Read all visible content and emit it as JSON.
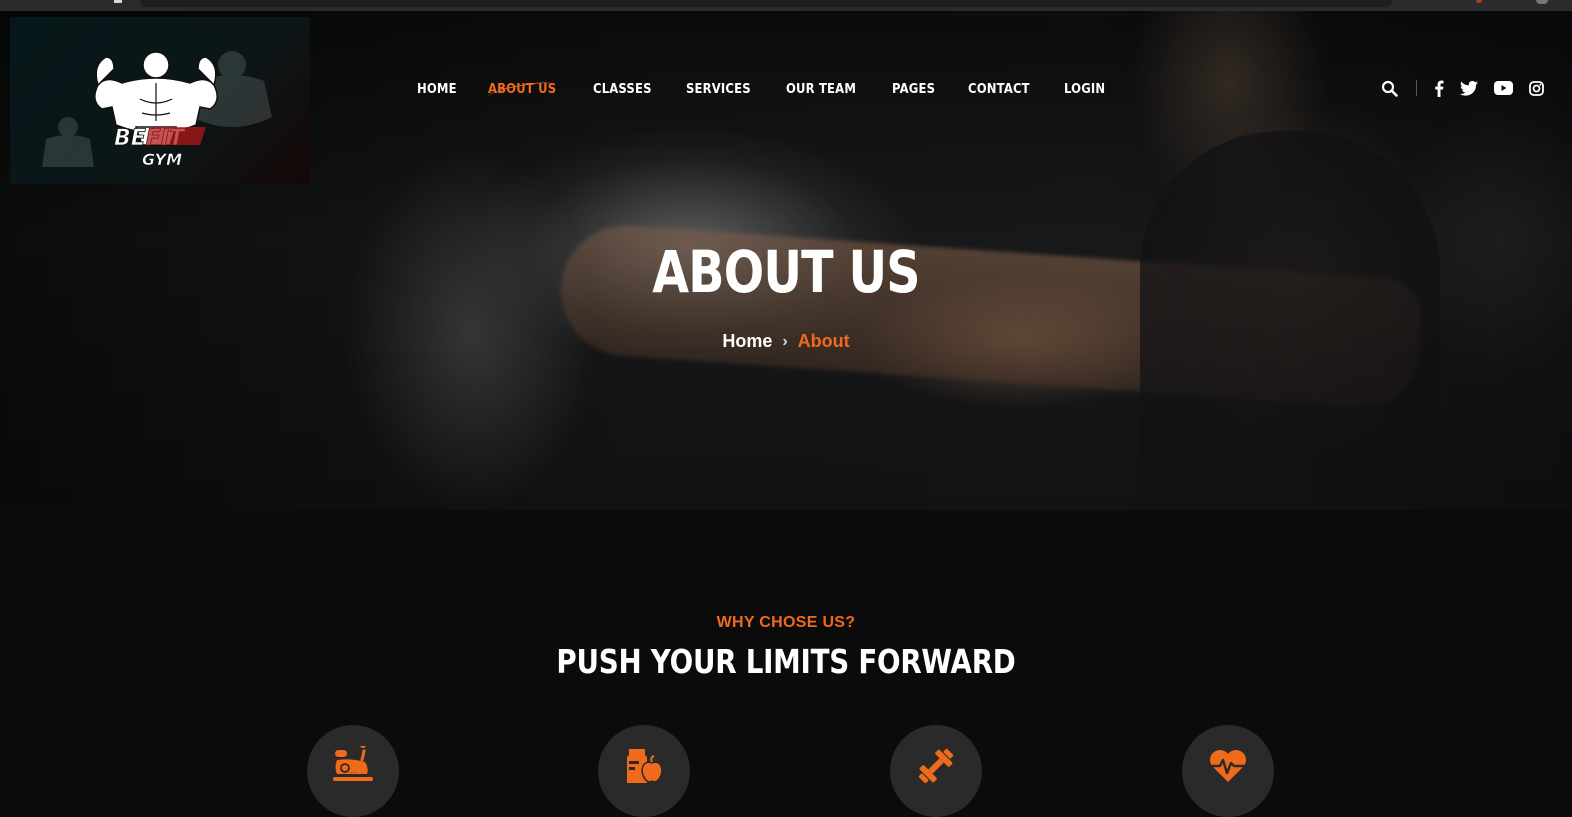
{
  "logo": {
    "line1": "BEFIT",
    "line2": "GYM"
  },
  "nav": {
    "items": [
      {
        "label": "HOME"
      },
      {
        "label": "ABOUT US"
      },
      {
        "label": "CLASSES"
      },
      {
        "label": "SERVICES"
      },
      {
        "label": "OUR TEAM"
      },
      {
        "label": "PAGES"
      },
      {
        "label": "CONTACT"
      },
      {
        "label": "LOGIN"
      }
    ],
    "active_index": 1
  },
  "header_icons": [
    "search-icon",
    "facebook-icon",
    "twitter-icon",
    "youtube-icon",
    "instagram-icon"
  ],
  "hero": {
    "title": "ABOUT US",
    "breadcrumb": {
      "home": "Home",
      "separator": "›",
      "current": "About"
    }
  },
  "why": {
    "eyebrow": "WHY CHOSE US?",
    "headline": "PUSH YOUR LIMITS FORWARD",
    "features": [
      "exercise-bike-icon",
      "nutrition-icon",
      "dumbbell-icon",
      "heart-rate-icon"
    ]
  },
  "colors": {
    "accent": "#f06a1c",
    "background": "#0b0b0b",
    "circle": "#2a2a2a"
  }
}
